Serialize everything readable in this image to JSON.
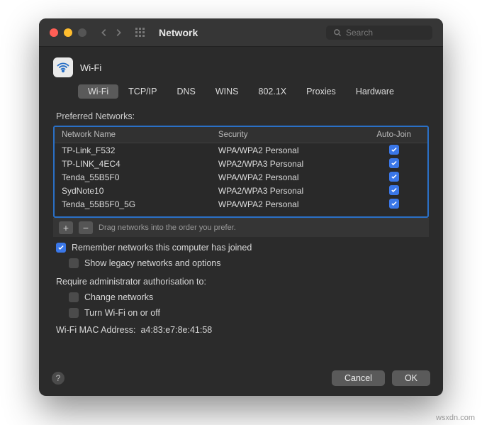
{
  "window": {
    "title": "Network"
  },
  "search": {
    "placeholder": "Search"
  },
  "pane": {
    "icon_label": "Wi-Fi"
  },
  "tabs": [
    "Wi-Fi",
    "TCP/IP",
    "DNS",
    "WINS",
    "802.1X",
    "Proxies",
    "Hardware"
  ],
  "active_tab": "Wi-Fi",
  "preferred_label": "Preferred Networks:",
  "columns": {
    "name": "Network Name",
    "security": "Security",
    "autojoin": "Auto-Join"
  },
  "networks": [
    {
      "name": "TP-Link_F532",
      "security": "WPA/WPA2 Personal",
      "autojoin": true
    },
    {
      "name": "TP-LINK_4EC4",
      "security": "WPA2/WPA3 Personal",
      "autojoin": true
    },
    {
      "name": "Tenda_55B5F0",
      "security": "WPA/WPA2 Personal",
      "autojoin": true
    },
    {
      "name": "SydNote10",
      "security": "WPA2/WPA3 Personal",
      "autojoin": true
    },
    {
      "name": "Tenda_55B5F0_5G",
      "security": "WPA/WPA2 Personal",
      "autojoin": true
    }
  ],
  "footer_hint": "Drag networks into the order you prefer.",
  "options": {
    "remember": {
      "label": "Remember networks this computer has joined",
      "checked": true
    },
    "legacy": {
      "label": "Show legacy networks and options",
      "checked": false
    },
    "require_label": "Require administrator authorisation to:",
    "change_net": {
      "label": "Change networks",
      "checked": false
    },
    "turn_wifi": {
      "label": "Turn Wi-Fi on or off",
      "checked": false
    }
  },
  "mac": {
    "label": "Wi-Fi MAC Address:",
    "value": "a4:83:e7:8e:41:58"
  },
  "buttons": {
    "cancel": "Cancel",
    "ok": "OK"
  },
  "watermark": "wsxdn.com"
}
